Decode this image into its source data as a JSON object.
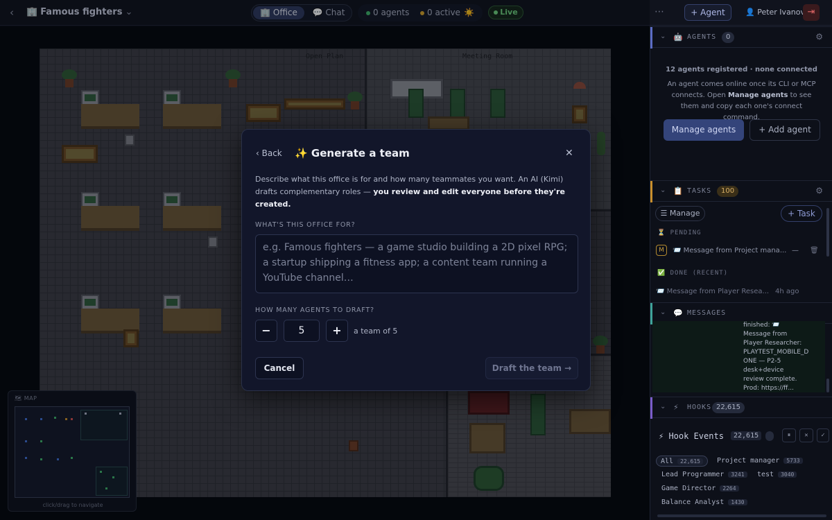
{
  "topbar": {
    "back_icon": "‹",
    "office_icon": "🏢",
    "title": "Famous fighters",
    "title_chevron": "⌄",
    "tabs": [
      {
        "icon": "🏢",
        "label": "Office",
        "active": true
      },
      {
        "icon": "💬",
        "label": "Chat",
        "active": false
      }
    ],
    "agents_status": "0 agents",
    "active_status": "0 active",
    "weather_icon": "☀️",
    "live_label": "Live",
    "more_icon": "⋯",
    "add_agent_label": "+ Agent",
    "user_icon": "👤",
    "user_name": "Peter Ivanov",
    "logout_icon": "⇥"
  },
  "map": {
    "zones": [
      "Open Plan",
      "Meeting Room"
    ],
    "minimap_title": "🗺 MAP",
    "minimap_caption": "click/drag to navigate"
  },
  "panel": {
    "agents": {
      "title": "AGENTS",
      "icon": "🤖",
      "count": "0",
      "summary": "12 agents registered · none connected",
      "help_before": "An agent comes online once its CLI or MCP connects. Open ",
      "help_bold": "Manage agents",
      "help_after": " to see them and copy each one's connect command.",
      "manage_label": "Manage agents",
      "add_label": "+ Add agent"
    },
    "tasks": {
      "title": "TASKS",
      "icon": "📋",
      "count": "100",
      "manage_label": "☰ Manage",
      "add_label": "+ Task",
      "pending_label": "PENDING",
      "pending_icon": "⏳",
      "pending_items": [
        {
          "badge": "M",
          "text": "📨 Message from Project mana...",
          "meta": "—"
        }
      ],
      "done_label": "DONE (RECENT)",
      "done_icon": "✅",
      "done_items": [
        {
          "text": "📨 Message from Player Resea...",
          "meta": "4h ago"
        }
      ]
    },
    "messages": {
      "title": "MESSAGES",
      "icon": "💬",
      "snippet": "finished: 📨 Message from Player Researcher: PLAYTEST_MOBILE_D ONE — P2-5 desk+device review complete. Prod: https://ff..."
    },
    "hooks": {
      "title": "HOOKS",
      "icon": "⚡",
      "count": "22,615",
      "events_title": "⚡ Hook Events",
      "events_count": "22,615",
      "pause_icon": "⏸",
      "clear_icon": "✕",
      "check_icon": "✓",
      "filters": [
        {
          "label": "All",
          "count": "22,615",
          "active": true
        },
        {
          "label": "Project manager",
          "count": "5733"
        },
        {
          "label": "Lead Programmer",
          "count": "3241"
        },
        {
          "label": "test",
          "count": "3040"
        },
        {
          "label": "Game Director",
          "count": "2264"
        },
        {
          "label": "Balance Analyst",
          "count": "1430"
        }
      ]
    }
  },
  "modal": {
    "back_label": "‹ Back",
    "title": "✨ Generate a team",
    "close_icon": "✕",
    "description_before": "Describe what this office is for and how many teammates you want. An AI (Kimi) drafts complementary roles — ",
    "description_bold": "you review and edit everyone before they're created.",
    "purpose_label": "WHAT'S THIS OFFICE FOR?",
    "purpose_value": "",
    "purpose_placeholder": "e.g. Famous fighters — a game studio building a 2D pixel RPG; a startup shipping a fitness app; a content team running a YouTube channel…",
    "count_label": "HOW MANY AGENTS TO DRAFT?",
    "minus_label": "−",
    "count_value": "5",
    "plus_label": "+",
    "team_of": "a team of 5",
    "cancel_label": "Cancel",
    "draft_label": "Draft the team →"
  },
  "colors": {
    "agents_accent": "#5b6cc4",
    "tasks_accent": "#c98f2c",
    "messages_accent": "#3fa39a",
    "hooks_accent": "#7a5cc9",
    "live_green": "#6fd17f",
    "status_green": "#3fb36a",
    "status_amber": "#d4a22a"
  }
}
